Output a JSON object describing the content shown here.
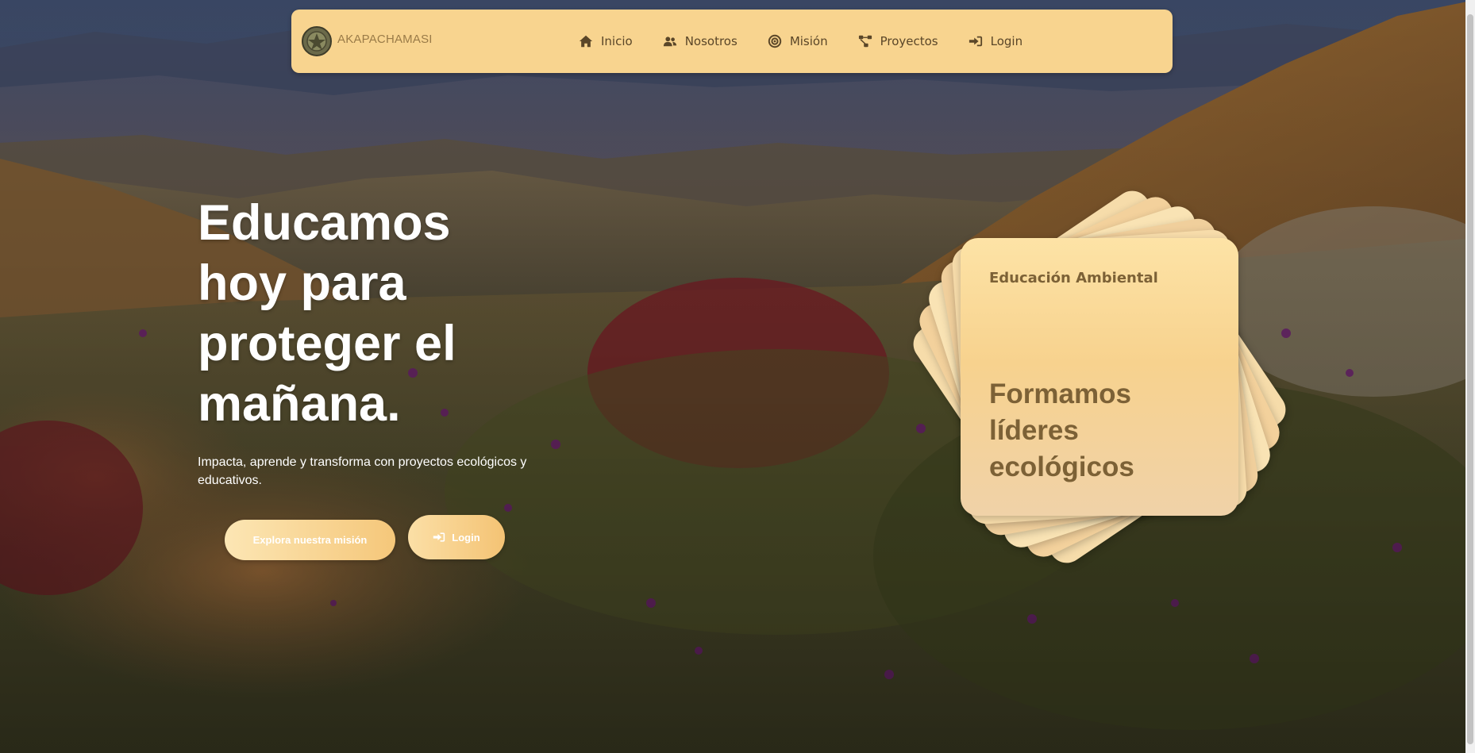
{
  "brand": {
    "name": "AKAPACHAMASI",
    "logo_icon": "badge-emblem-icon"
  },
  "nav": {
    "items": [
      {
        "label": "Inicio",
        "icon": "home-icon"
      },
      {
        "label": "Nosotros",
        "icon": "users-icon"
      },
      {
        "label": "Misión",
        "icon": "target-icon"
      },
      {
        "label": "Proyectos",
        "icon": "project-diagram-icon"
      },
      {
        "label": "Login",
        "icon": "sign-in-icon"
      }
    ]
  },
  "hero": {
    "title_lines": [
      "Educamos",
      "hoy para",
      "proteger el",
      "mañana."
    ],
    "subtitle": "Impacta, aprende y transforma con proyectos ecológicos y educativos.",
    "primary_button": "Explora nuestra misión",
    "secondary_button": "Login"
  },
  "card": {
    "eyebrow": "Educación Ambiental",
    "headline_lines": [
      "Formamos",
      "líderes",
      "ecológicos"
    ]
  },
  "colors": {
    "navbar_bg": "#f8d48f",
    "nav_text": "#5a4628",
    "card_text": "#7c6136",
    "button_gradient_start": "#fce6b4",
    "button_gradient_end": "#f5c77a"
  }
}
